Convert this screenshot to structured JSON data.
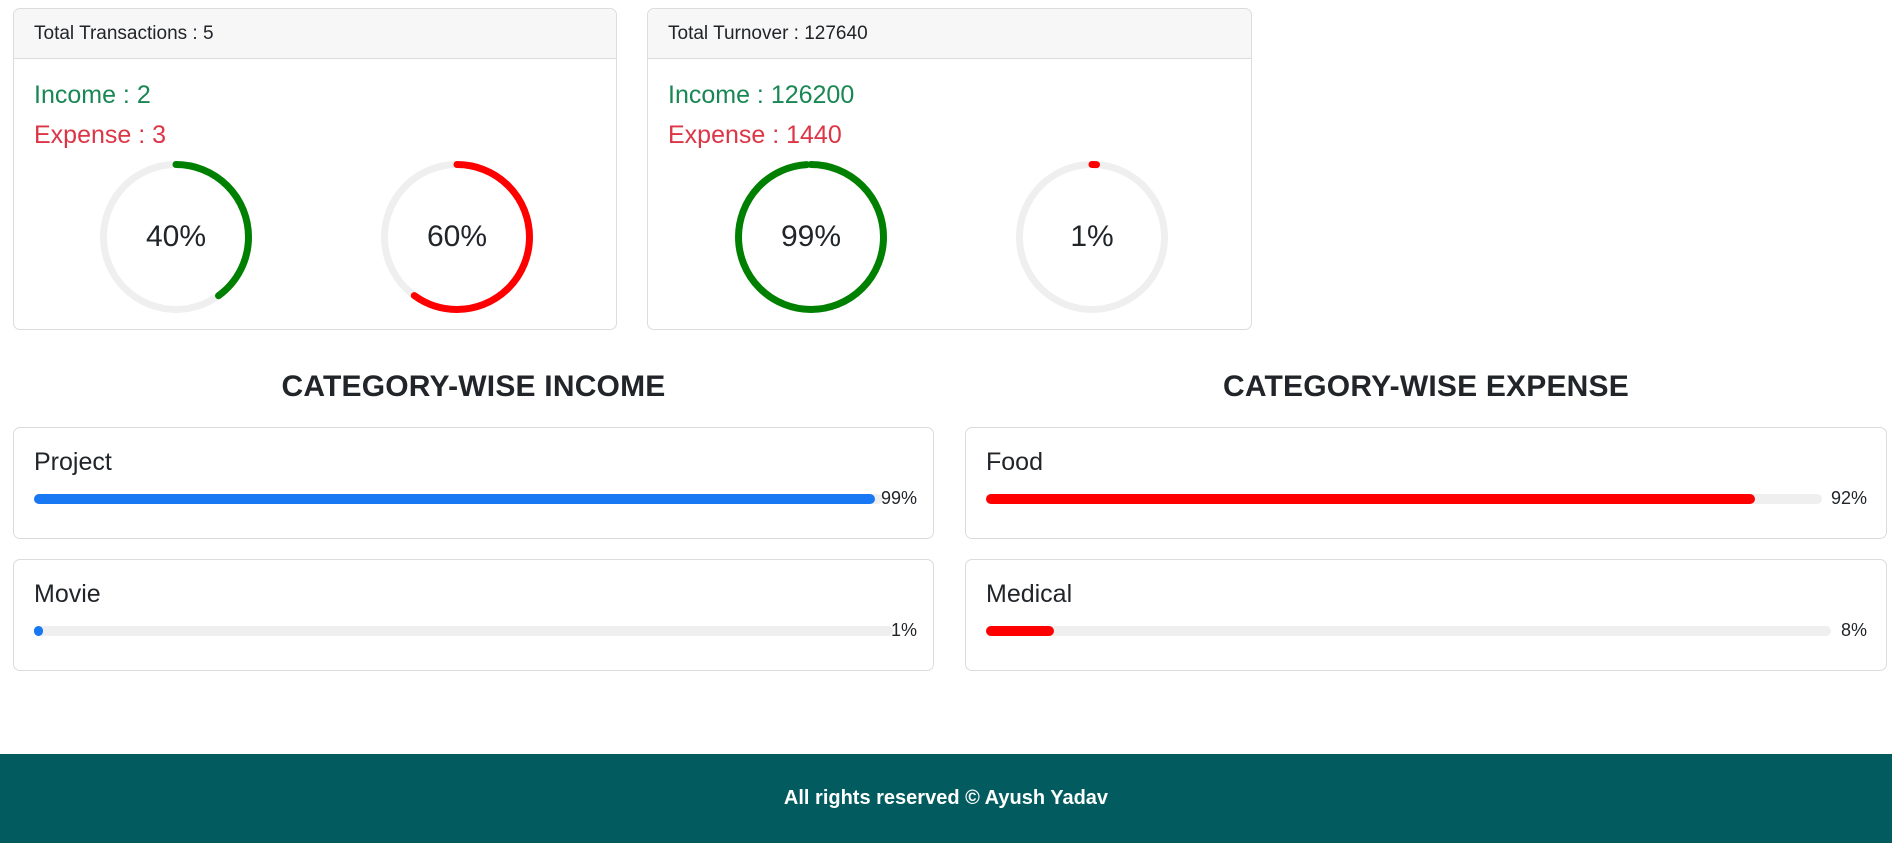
{
  "transactions_card": {
    "header": "Total Transactions : 5",
    "income_label": "Income : 2",
    "expense_label": "Expense : 3",
    "income_ring": {
      "label": "40%",
      "percent": 40,
      "color": "#008000"
    },
    "expense_ring": {
      "label": "60%",
      "percent": 60,
      "color": "#ff0000"
    }
  },
  "turnover_card": {
    "header": "Total Turnover : 127640",
    "income_label": "Income : 126200",
    "expense_label": "Expense : 1440",
    "income_ring": {
      "label": "99%",
      "percent": 99,
      "color": "#008000"
    },
    "expense_ring": {
      "label": "1%",
      "percent": 1,
      "color": "#ff0000"
    }
  },
  "colors": {
    "income_text": "#198754",
    "expense_text": "#dc3545",
    "income_bar": "#1877f2",
    "expense_bar": "#ff0000",
    "ring_track": "#efefef",
    "footer_bg": "#025c5f"
  },
  "income_section": {
    "title": "CATEGORY-WISE INCOME",
    "items": [
      {
        "name": "Project",
        "label": "99%",
        "percent": 99
      },
      {
        "name": "Movie",
        "label": "1%",
        "percent": 1
      }
    ]
  },
  "expense_section": {
    "title": "CATEGORY-WISE EXPENSE",
    "items": [
      {
        "name": "Food",
        "label": "92%",
        "percent": 92
      },
      {
        "name": "Medical",
        "label": "8%",
        "percent": 8
      }
    ]
  },
  "footer": {
    "text": "All rights reserved © Ayush Yadav"
  }
}
